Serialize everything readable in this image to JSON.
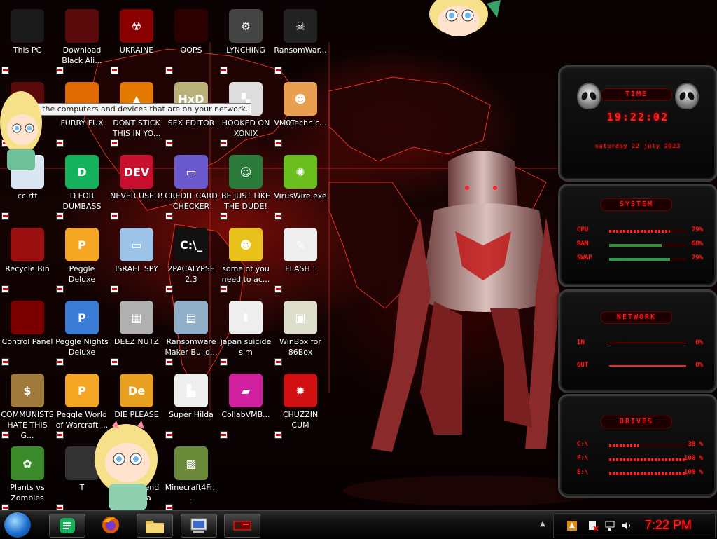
{
  "desktop": {
    "icons": [
      {
        "id": "this-pc",
        "label": "This PC",
        "glyph": "",
        "color": "#1a1a1a"
      },
      {
        "id": "download-black-ali",
        "label": "Download Black Ali...",
        "glyph": "",
        "color": "#5a0a0a"
      },
      {
        "id": "ukraine",
        "label": "UKRAINE",
        "glyph": "☢",
        "color": "#8a0000"
      },
      {
        "id": "oops",
        "label": "OOPS",
        "glyph": "",
        "color": "#2a0000"
      },
      {
        "id": "lynching",
        "label": "LYNCHING",
        "glyph": "⚙",
        "color": "#444444"
      },
      {
        "id": "ransomwar",
        "label": "RansomWar...",
        "glyph": "☠",
        "color": "#222222"
      },
      {
        "id": "network",
        "label": "rk",
        "glyph": "",
        "color": "#5a0a0a"
      },
      {
        "id": "furry-fux",
        "label": "FURRY FUX",
        "glyph": "",
        "color": "#e06a00"
      },
      {
        "id": "dont-stick",
        "label": "DONT STICK THIS IN YO...",
        "glyph": "▲",
        "color": "#e47a00"
      },
      {
        "id": "sex-editor",
        "label": "SEX EDITOR",
        "glyph": "HxD",
        "color": "#b9b07a"
      },
      {
        "id": "hooked-on-xonix",
        "label": "HOOKED ON XONIX",
        "glyph": "▚",
        "color": "#dddddd"
      },
      {
        "id": "vm0technic",
        "label": "VM0Technic...",
        "glyph": "☻",
        "color": "#e8a050"
      },
      {
        "id": "cc-rtf",
        "label": "cc.rtf",
        "glyph": "",
        "color": "#dbe6f5"
      },
      {
        "id": "d-for-dumbass",
        "label": "D FOR DUMBASS",
        "glyph": "D",
        "color": "#14b25a"
      },
      {
        "id": "never-used",
        "label": "NEVER USED!",
        "glyph": "DEV",
        "color": "#c8102e"
      },
      {
        "id": "credit-card-checker",
        "label": "CREDIT CARD CHECKER",
        "glyph": "▭",
        "color": "#6a5acd"
      },
      {
        "id": "be-just-like-the-dude",
        "label": "BE JUST LIKE THE DUDE!",
        "glyph": "☺",
        "color": "#2a7a3a"
      },
      {
        "id": "viruswire-exe",
        "label": "VirusWire.exe",
        "glyph": "✺",
        "color": "#6abe1e"
      },
      {
        "id": "recycle-bin",
        "label": "Recycle Bin",
        "glyph": "",
        "color": "#9a1010"
      },
      {
        "id": "peggle-deluxe",
        "label": "Peggle Deluxe",
        "glyph": "P",
        "color": "#f5a623"
      },
      {
        "id": "israel-spy",
        "label": "ISRAEL SPY",
        "glyph": "▭",
        "color": "#9ec3e8"
      },
      {
        "id": "2pacalypse",
        "label": "2PACALYPSE 2.3",
        "glyph": "C:\\_",
        "color": "#111111"
      },
      {
        "id": "some-of-you",
        "label": "some of you need to ac...",
        "glyph": "☻",
        "color": "#e8c21a"
      },
      {
        "id": "flash",
        "label": "FLASH !",
        "glyph": "✎",
        "color": "#eeeeee"
      },
      {
        "id": "control-panel",
        "label": "Control Panel",
        "glyph": "",
        "color": "#7a0000"
      },
      {
        "id": "peggle-nights",
        "label": "Peggle Nights Deluxe",
        "glyph": "P",
        "color": "#3a7bd5"
      },
      {
        "id": "deez-nutz",
        "label": "DEEZ NUTZ",
        "glyph": "▦",
        "color": "#b0b0b0"
      },
      {
        "id": "ransomware-maker",
        "label": "Ransomware Maker Build...",
        "glyph": "▤",
        "color": "#8fb0c8"
      },
      {
        "id": "japan-suicide-sim",
        "label": "japan suicide sim",
        "glyph": "⬇",
        "color": "#eeeeee"
      },
      {
        "id": "winbox-86box",
        "label": "WinBox for 86Box",
        "glyph": "▣",
        "color": "#ddddcc"
      },
      {
        "id": "communists",
        "label": "COMMUNISTS HATE THIS G...",
        "glyph": "$",
        "color": "#a07a3a"
      },
      {
        "id": "peggle-world",
        "label": "Peggle World of Warcraft ...",
        "glyph": "P",
        "color": "#f5a623"
      },
      {
        "id": "die-please",
        "label": "DIE PLEASE",
        "glyph": "De",
        "color": "#e8a020"
      },
      {
        "id": "super-hilda",
        "label": "Super Hilda",
        "glyph": "▙",
        "color": "#eeeeee"
      },
      {
        "id": "collabvmb",
        "label": "CollabVMB...",
        "glyph": "▰",
        "color": "#d020a0"
      },
      {
        "id": "chuzzin-cum",
        "label": "CHUZZIN CUM",
        "glyph": "✹",
        "color": "#d01010"
      },
      {
        "id": "plants-vs-zombies",
        "label": "Plants vs Zombies",
        "glyph": "✿",
        "color": "#3a8a2a"
      },
      {
        "id": "obscured",
        "label": "T",
        "glyph": "",
        "color": "#333333"
      },
      {
        "id": "legend-of-zilda",
        "label": "The Legend of Zilda",
        "glyph": "♞",
        "color": "#2a8a4a"
      },
      {
        "id": "minecraft4fr",
        "label": "Minecraft4Fr...",
        "glyph": "▩",
        "color": "#6a8a3a"
      }
    ],
    "tooltip": "Access the computers and devices that are on your network."
  },
  "widgets": {
    "clock": {
      "title": "TIME",
      "time": "19:22:02",
      "date": "saturday 22 july 2023"
    },
    "system": {
      "title": "SYSTEM",
      "rows": [
        {
          "key": "CPU",
          "value": "79%",
          "level": 0.79
        },
        {
          "key": "RAM",
          "value": "68%",
          "level": 0.68
        },
        {
          "key": "SWAP",
          "value": "79%",
          "level": 0.79
        }
      ]
    },
    "network": {
      "title": "NETWORK",
      "rows": [
        {
          "key": "IN",
          "value": "0%"
        },
        {
          "key": "OUT",
          "value": "0%"
        }
      ]
    },
    "drives": {
      "title": "DRIVES",
      "rows": [
        {
          "key": "C:\\",
          "value": "38 %",
          "level": 0.38
        },
        {
          "key": "F:\\",
          "value": "100 %",
          "level": 1.0
        },
        {
          "key": "E:\\",
          "value": "100 %",
          "level": 1.0
        }
      ]
    }
  },
  "taskbar": {
    "apps": [
      {
        "id": "d-app"
      },
      {
        "id": "firefox"
      },
      {
        "id": "file-explorer"
      },
      {
        "id": "winbox"
      },
      {
        "id": "control-panel"
      }
    ],
    "tray": {
      "clock": "7:22 PM"
    }
  },
  "colors": {
    "accent": "#ff2222",
    "widget_text": "#ff2a2a"
  }
}
